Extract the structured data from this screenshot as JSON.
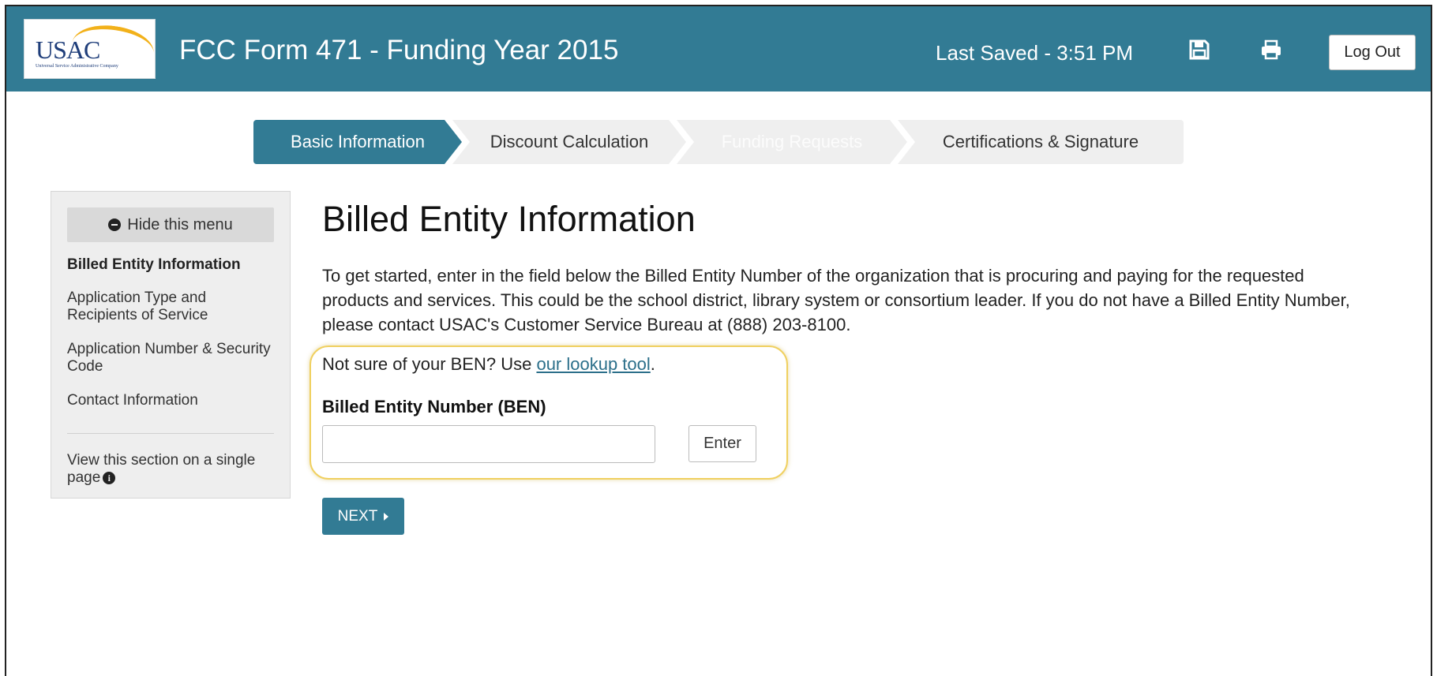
{
  "header": {
    "logo_text": "USAC",
    "logo_subtext": "Universal Service Administrative Company",
    "title": "FCC Form 471 - Funding Year 2015",
    "last_saved": "Last Saved - 3:51 PM",
    "save_icon": "floppy-disk-icon",
    "print_icon": "printer-icon",
    "logout_label": "Log Out",
    "color": "#327b94"
  },
  "steps": [
    {
      "label": "Basic Information",
      "state": "active"
    },
    {
      "label": "Discount Calculation",
      "state": "inactive"
    },
    {
      "label": "Funding Requests",
      "state": "disabled"
    },
    {
      "label": "Certifications & Signature",
      "state": "inactive"
    }
  ],
  "sidebar": {
    "hide_menu_label": "Hide this menu",
    "items": [
      {
        "label": "Billed Entity Information",
        "active": true
      },
      {
        "label": "Application Type and Recipients of Service",
        "active": false
      },
      {
        "label": "Application Number & Security Code",
        "active": false
      },
      {
        "label": "Contact Information",
        "active": false
      }
    ],
    "single_page_label": "View this section on a single page"
  },
  "main": {
    "title": "Billed Entity Information",
    "intro": "To get started, enter in the field below the Billed Entity Number of the organization that is procuring and paying for the requested products and services. This could be the school district, library system or consortium leader. If you do not have a Billed Entity Number, please contact USAC's Customer Service Bureau at (888) 203-8100.",
    "lookup_prefix": "Not sure of your BEN? Use ",
    "lookup_link": "our lookup tool",
    "lookup_suffix": ".",
    "ben_label": "Billed Entity Number (BEN)",
    "ben_value": "",
    "ben_placeholder": "",
    "enter_label": "Enter",
    "next_label": "NEXT"
  }
}
